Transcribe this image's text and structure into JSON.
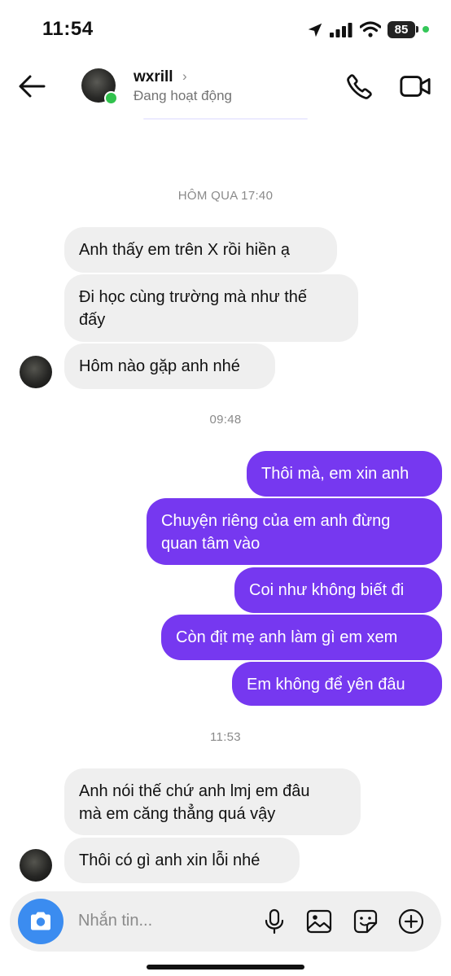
{
  "status": {
    "time": "11:54",
    "battery": "85"
  },
  "header": {
    "name": "wxrill",
    "name_chevron": "›",
    "activity": "Đang hoạt động"
  },
  "messages": {
    "stamp1": "HÔM QUA 17:40",
    "m1": "Anh thấy em trên X rồi hiền ạ",
    "m2": "Đi học cùng trường mà như thế\nđấy",
    "m3": "Hôm nào gặp anh nhé",
    "stamp2": "09:48",
    "m4": "Thôi mà, em xin anh",
    "m5": "Chuyện riêng của em anh đừng\nquan tâm vào",
    "m6": "Coi như không biết đi",
    "m7": "Còn địt mẹ anh làm gì em xem",
    "m8": "Em không để yên đâu",
    "stamp3": "11:53",
    "m9": "Anh nói thế chứ anh lmj em đâu\nmà em căng thẳng quá vậy",
    "m10": "Thôi có gì anh xin lỗi nhé"
  },
  "composer": {
    "placeholder": "Nhắn tin..."
  },
  "colors": {
    "outgoing": "#7638f0",
    "incoming": "#efefef",
    "camera": "#3b8cf0",
    "online": "#31c24d"
  },
  "icons": [
    "location-arrow-icon",
    "signal-icon",
    "wifi-icon",
    "battery-icon",
    "back-arrow-icon",
    "phone-icon",
    "video-camera-icon",
    "camera-icon",
    "microphone-icon",
    "image-icon",
    "sticker-icon",
    "plus-icon"
  ]
}
